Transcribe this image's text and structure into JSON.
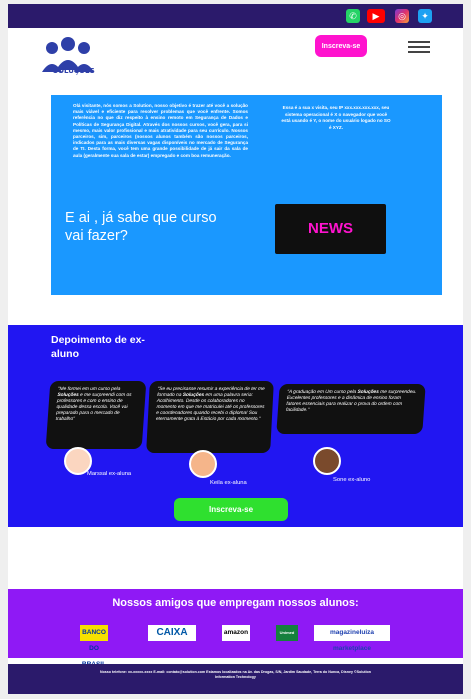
{
  "social": {
    "whatsapp": "whatsapp-icon",
    "youtube": "youtube-icon",
    "instagram": "instagram-icon",
    "twitter": "twitter-icon"
  },
  "header": {
    "logo_text": "SOLUÇÕES",
    "cta_label": "Inscreva-se"
  },
  "hero": {
    "intro": "Olá visitante, nós somos a Solution, nosso objetivo é trazer até você a solução mais viável e eficiente para resolver problemas que você enfrente. Somos referência no que diz respeito à ensino remoto em Segurança de Dados e Políticas de Segurança Digital. Através dos nossos cursos, você gera, para si mesmo, mais valor profissional e mais atratividade para seu currículo. Nossos parceiros, sim, parceiros (nossos alunos também são nossos parceiros, indicados para as mais diversas vagas disponíveis no mercado de Segurança de TI. Desta forma, você tem uma grande possibilidade de já sair da sala de aula (geralmente sua sala de estar) empregado e com boa remuneração.",
    "side": "Essa é a sua x visita, seu IP xxx.xxx.xxx.xxx, seu sistema operacional é X o navegador que você está usando é Y, o nome do usuário logado no SO é XYZ.",
    "question": "E ai , já sabe que curso vai  fazer?",
    "news_label": "NEWS"
  },
  "testimonials": {
    "title": "Depoimento de ex-aluno",
    "items": [
      {
        "pre": "\"Me formei em um curso pela ",
        "brand": "Soluções",
        "post": " e me surpreendi com os professores e com o ensino de qualidade dessa escola. Você vai preparado para o mercado de trabalho\"",
        "name": "Marssal ex-aluna"
      },
      {
        "pre": "\"Se eu precisasse resumir a experiência de ter me formado na ",
        "brand": "Soluções",
        "post": " em uma palavra seria: Acolhimento. Desde os colaboradores no momento em que me matriculei até os professores e coordenadores quando recebi o diploma! Sou eternamente grata à Estácio por cada momento.\"",
        "name": "Keila ex-aluna"
      },
      {
        "pre": "\"A graduação em Um curso pela ",
        "brand": "Soluções",
        "post": " me surpreendeu. Excelentes professores e a dinâmica de ensino foram fatores essenciais para realizar o prova do ordem com facilidade.\"",
        "name": "Sone ex-aluno"
      }
    ],
    "cta_label": "Inscreva-se"
  },
  "partners": {
    "title": "Nossos amigos que empregam nossos alunos:",
    "logos": [
      "BANCO DO BRASIL",
      "CAIXA",
      "amazon",
      "Unimed",
      "magazineluiza marketplace"
    ]
  },
  "footer": {
    "text": "Nosso telefone: xx-xxxxx-xxxx E-mail: contato@solution.com Estamos localizados na Av. das Drogas, S/N, Jardim Saudade, Terra do Nunca, Disney ©Solution Information Technology"
  }
}
